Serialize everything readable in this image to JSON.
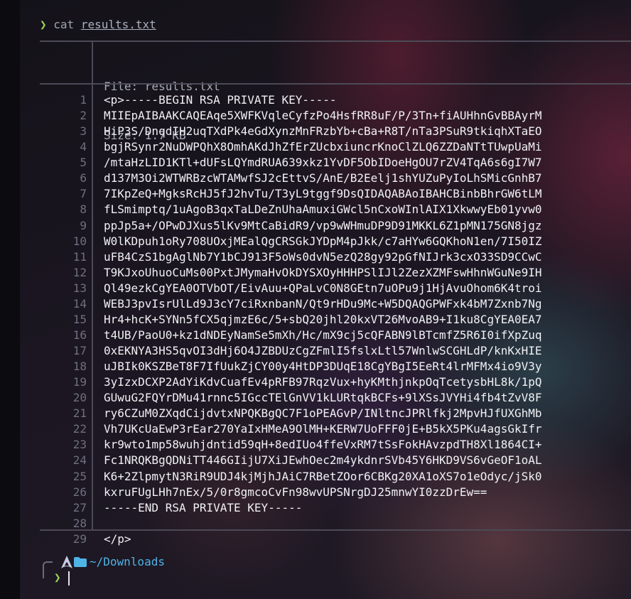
{
  "command": {
    "prompt_symbol": "❯",
    "name": "cat",
    "argument": "results.txt"
  },
  "file_header": {
    "file_line": "File: results.txt",
    "size_line": "Size: 1.7 KB"
  },
  "lines": [
    {
      "n": "1",
      "text": "<p>-----BEGIN RSA PRIVATE KEY-----"
    },
    {
      "n": "2",
      "text": "MIIEpAIBAAKCAQEAqe5XWFKVqleCyfzPo4HsfRR8uF/P/3Tn+fiAUHhnGvBBAyrM"
    },
    {
      "n": "3",
      "text": "HiP3S/DnqdIH2uqTXdPk4eGdXynzMnFRzbYb+cBa+R8T/nTa3PSuR9tkiqhXTaEO"
    },
    {
      "n": "4",
      "text": "bgjRSynr2NuDWPQhX8OmhAKdJhZfErZUcbxiuncrKnoClZLQ6ZZDaNTtTUwpUaMi"
    },
    {
      "n": "5",
      "text": "/mtaHzLID1KTl+dUFsLQYmdRUA639xkz1YvDF5ObIDoeHgOU7rZV4TqA6s6gI7W7"
    },
    {
      "n": "6",
      "text": "d137M3Oi2WTWRBzcWTAMwfSJ2cEttvS/AnE/B2Eelj1shYUZuPyIoLhSMicGnhB7"
    },
    {
      "n": "7",
      "text": "7IKpZeQ+MgksRcHJ5fJ2hvTu/T3yL9tggf9DsQIDAQABAoIBAHCBinbBhrGW6tLM"
    },
    {
      "n": "8",
      "text": "fLSmimptq/1uAgoB3qxTaLDeZnUhaAmuxiGWcl5nCxoWInlAIX1XkwwyEb01yvw0"
    },
    {
      "n": "9",
      "text": "ppJp5a+/OPwDJXus5lKv9MtCaBidR9/vp9wWHmuDP9D91MKKL6Z1pMN175GN8jgz"
    },
    {
      "n": "10",
      "text": "W0lKDpuh1oRy708UOxjMEalQgCRSGkJYDpM4pJkk/c7aHYw6GQKhoN1en/7I50IZ"
    },
    {
      "n": "11",
      "text": "uFB4CzS1bgAglNb7Y1bCJ913F5oWs0dvN5ezQ28gy92pGfNIJrk3cxO33SD9CCwC"
    },
    {
      "n": "12",
      "text": "T9KJxoUhuoCuMs00PxtJMymaHvOkDYSXOyHHHPSlIJl2ZezXZMFswHhnWGuNe9IH"
    },
    {
      "n": "13",
      "text": "Ql49ezkCgYEA0OTVbOT/EivAuu+QPaLvC0N8GEtn7uOPu9j1HjAvuOhom6K4troi"
    },
    {
      "n": "14",
      "text": "WEBJ3pvIsrUlLd9J3cY7ciRxnbanN/Qt9rHDu9Mc+W5DQAQGPWFxk4bM7Zxnb7Ng"
    },
    {
      "n": "15",
      "text": "Hr4+hcK+SYNn5fCX5qjmzE6c/5+sbQ20jhl20kxVT26MvoAB9+I1ku8CgYEA0EA7"
    },
    {
      "n": "16",
      "text": "t4UB/PaoU0+kz1dNDEyNamSe5mXh/Hc/mX9cj5cQFABN9lBTcmfZ5R6I0ifXpZuq"
    },
    {
      "n": "17",
      "text": "0xEKNYA3HS5qvOI3dHj6O4JZBDUzCgZFmlI5fslxLtl57WnlwSCGHLdP/knKxHIE"
    },
    {
      "n": "18",
      "text": "uJBIk0KSZBeT8F7IfUukZjCY00y4HtDP3DUqE18CgYBgI5EeRt4lrMFMx4io9V3y"
    },
    {
      "n": "19",
      "text": "3yIzxDCXP2AdYiKdvCuafEv4pRFB97RqzVux+hyKMthjnkpOqTcetysbHL8k/1pQ"
    },
    {
      "n": "20",
      "text": "GUwuG2FQYrDMu41rnnc5IGccTElGnVV1kLURtqkBCFs+9lXSsJVYHi4fb4tZvV8F"
    },
    {
      "n": "21",
      "text": "ry6CZuM0ZXqdCijdvtxNPQKBgQC7F1oPEAGvP/INltncJPRlfkj2MpvHJfUXGhMb"
    },
    {
      "n": "22",
      "text": "Vh7UKcUaEwP3rEar270YaIxHMeA9OlMH+KERW7UoFFF0jE+B5kX5PKu4agsGkIfr"
    },
    {
      "n": "23",
      "text": "kr9wto1mp58wuhjdntid59qH+8edIUo4ffeVxRM7tSsFokHAvzpdTH8Xl1864CI+"
    },
    {
      "n": "24",
      "text": "Fc1NRQKBgQDNiTT446GIijU7XiJEwhOec2m4ykdnrSVb45Y6HKD9VS6vGeOF1oAL"
    },
    {
      "n": "25",
      "text": "K6+2ZlpmytN3RiR9UDJ4kjMjhJAiC7RBetZOor6CBKg20XA1oXS7o1eOdyc/jSk0"
    },
    {
      "n": "26",
      "text": "kxruFUgLHh7nEx/5/0r8gmcoCvFn98wvUPSNrgDJ25mnwYI0zzDrEw=="
    },
    {
      "n": "27",
      "text": "-----END RSA PRIVATE KEY-----"
    },
    {
      "n": "28",
      "text": ""
    },
    {
      "n": "29",
      "text": "</p>"
    }
  ],
  "bottom_prompt": {
    "path": "~/Downloads",
    "prompt_symbol": "❯"
  },
  "colors": {
    "prompt": "#9bd65a",
    "path": "#4fb3e6",
    "rule": "#4c4a56",
    "line_number": "#6e7080"
  },
  "icons": [
    "arch-linux-icon",
    "folder-icon"
  ]
}
